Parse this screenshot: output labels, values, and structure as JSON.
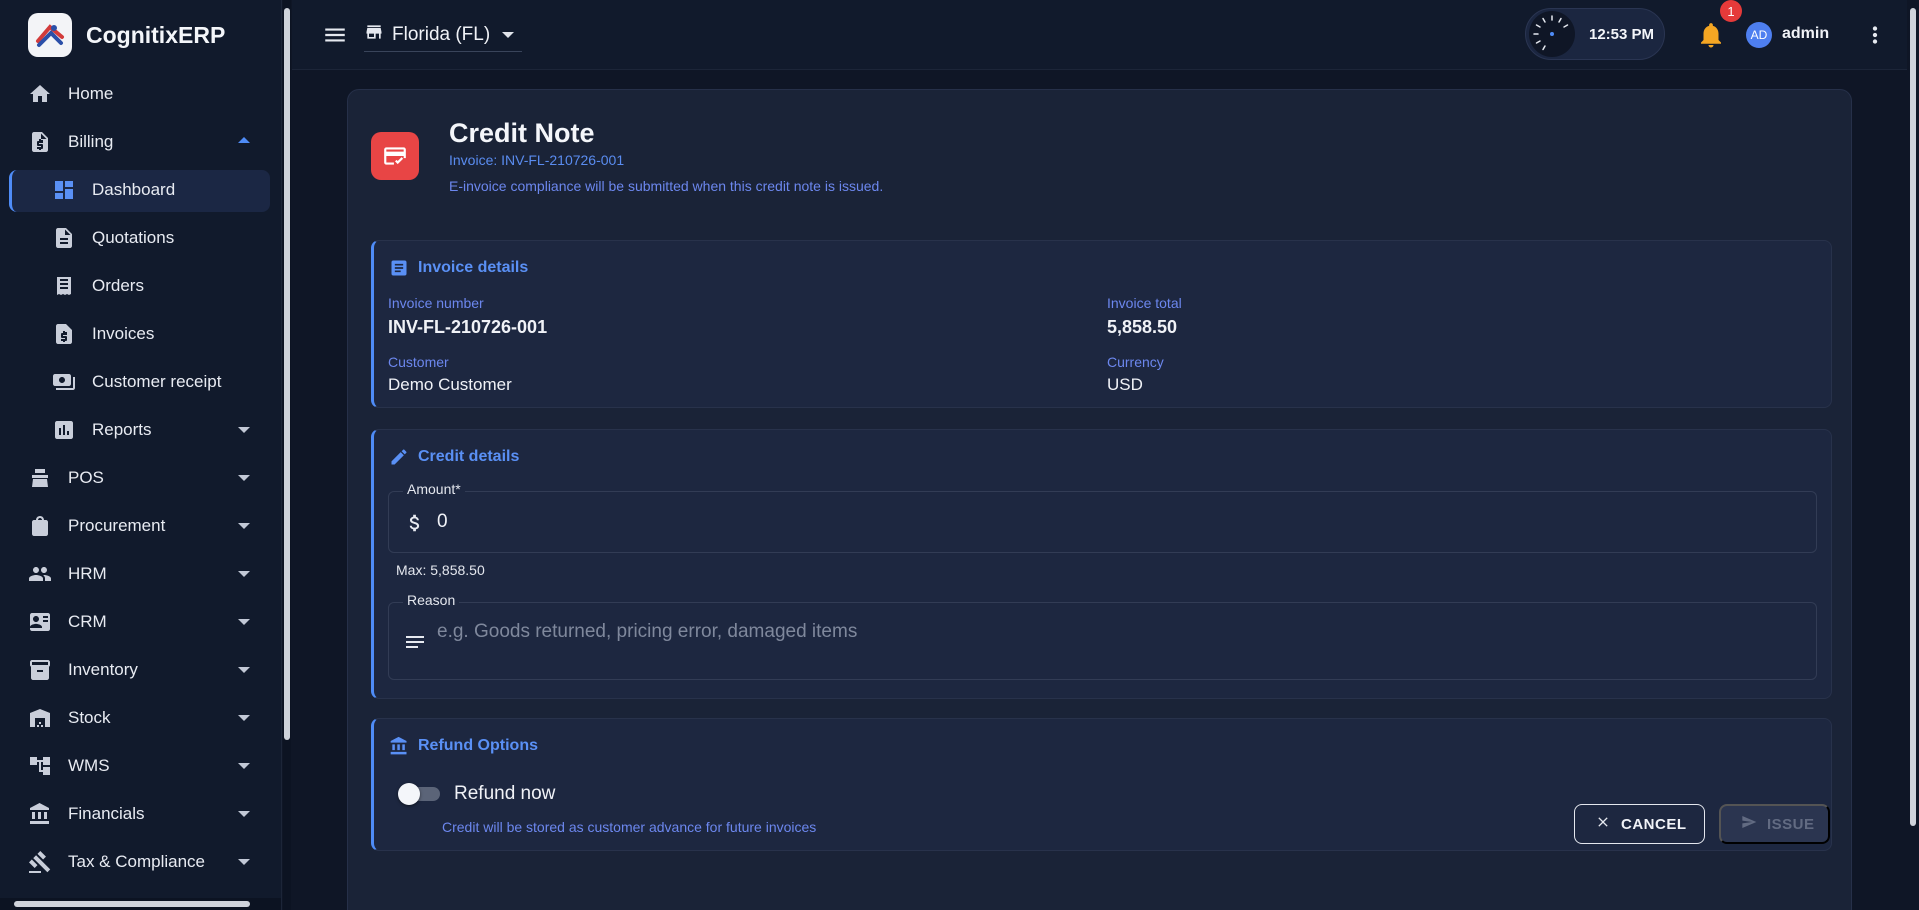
{
  "brand": {
    "name": "CognitixERP"
  },
  "sidebar": {
    "items": [
      {
        "label": "Home",
        "icon": "home-icon"
      },
      {
        "label": "Billing",
        "icon": "billing-icon",
        "expanded": true
      },
      {
        "label": "Dashboard",
        "icon": "dashboard-icon",
        "active": true
      },
      {
        "label": "Quotations",
        "icon": "document-icon"
      },
      {
        "label": "Orders",
        "icon": "receipt-icon"
      },
      {
        "label": "Invoices",
        "icon": "invoice-icon"
      },
      {
        "label": "Customer receipt",
        "icon": "cash-icon"
      },
      {
        "label": "Reports",
        "icon": "bar-chart-icon"
      },
      {
        "label": "POS",
        "icon": "pos-icon"
      },
      {
        "label": "Procurement",
        "icon": "shopping-bag-icon"
      },
      {
        "label": "HRM",
        "icon": "people-icon"
      },
      {
        "label": "CRM",
        "icon": "contact-card-icon"
      },
      {
        "label": "Inventory",
        "icon": "archive-icon"
      },
      {
        "label": "Stock",
        "icon": "warehouse-icon"
      },
      {
        "label": "WMS",
        "icon": "workflow-icon"
      },
      {
        "label": "Financials",
        "icon": "bank-icon"
      },
      {
        "label": "Tax & Compliance",
        "icon": "gavel-icon"
      }
    ]
  },
  "topbar": {
    "store": "Florida (FL)",
    "time": "12:53 PM",
    "notifications": "1",
    "avatar_initials": "AD",
    "user": "admin"
  },
  "page": {
    "title": "Credit Note",
    "invoice_ref": "Invoice: INV-FL-210726-001",
    "notice": "E-invoice compliance will be submitted when this credit note is issued."
  },
  "invoice_details": {
    "title": "Invoice details",
    "invoice_number_label": "Invoice number",
    "invoice_number": "INV-FL-210726-001",
    "invoice_total_label": "Invoice total",
    "invoice_total": "5,858.50",
    "customer_label": "Customer",
    "customer": "Demo Customer",
    "currency_label": "Currency",
    "currency": "USD"
  },
  "credit_details": {
    "title": "Credit details",
    "amount_label": "Amount*",
    "amount_value": "0",
    "max_helper": "Max: 5,858.50",
    "reason_label": "Reason",
    "reason_placeholder": "e.g. Goods returned, pricing error, damaged items"
  },
  "refund": {
    "title": "Refund Options",
    "toggle_label": "Refund now",
    "toggle_on": false,
    "helper": "Credit will be stored as customer advance for future invoices"
  },
  "actions": {
    "cancel": "CANCEL",
    "issue": "ISSUE"
  },
  "colors": {
    "accent": "#4f8cf7",
    "danger": "#e84545",
    "warning": "#f5a623"
  }
}
